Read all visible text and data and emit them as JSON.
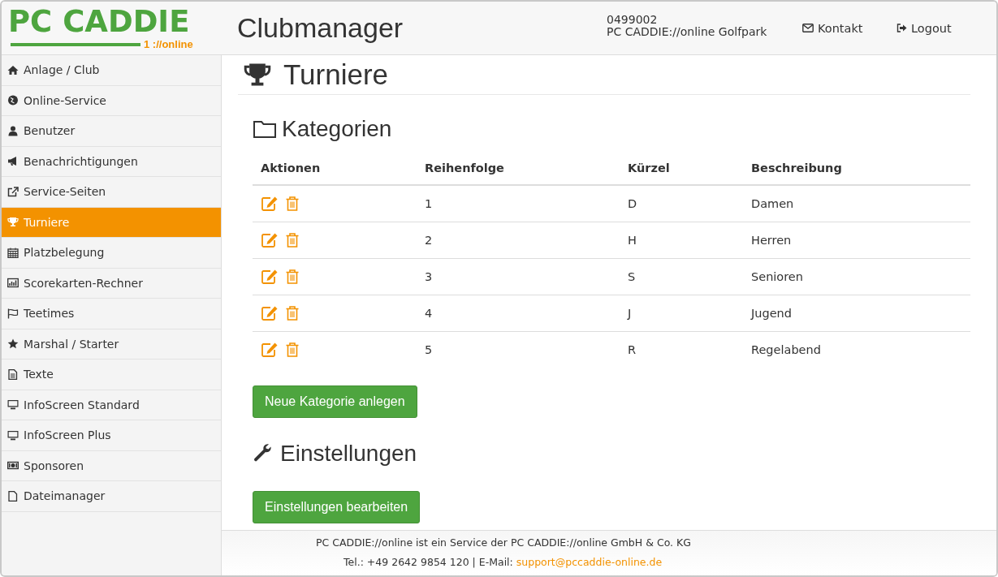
{
  "header": {
    "logo_text": "PC CADDIE",
    "logo_sub": "1 ://online",
    "app_title": "Clubmanager",
    "account_id": "0499002",
    "account_name": "PC CADDIE://online Golfpark",
    "links": [
      {
        "label": "Kontakt",
        "kind": "mail"
      },
      {
        "label": "Logout",
        "kind": "logout"
      }
    ]
  },
  "sidebar": {
    "items": [
      {
        "label": "Anlage / Club",
        "selected": false
      },
      {
        "label": "Online-Service",
        "selected": false
      },
      {
        "label": "Benutzer",
        "selected": false
      },
      {
        "label": "Benachrichtigungen",
        "selected": false
      },
      {
        "label": "Service-Seiten",
        "selected": false
      },
      {
        "label": "Turniere",
        "selected": true
      },
      {
        "label": "Platzbelegung",
        "selected": false
      },
      {
        "label": "Scorekarten-Rechner",
        "selected": false
      },
      {
        "label": "Teetimes",
        "selected": false
      },
      {
        "label": "Marshal / Starter",
        "selected": false
      },
      {
        "label": "Texte",
        "selected": false
      },
      {
        "label": "InfoScreen Standard",
        "selected": false
      },
      {
        "label": "InfoScreen Plus",
        "selected": false
      },
      {
        "label": "Sponsoren",
        "selected": false
      },
      {
        "label": "Dateimanager",
        "selected": false
      }
    ]
  },
  "page_title": "Turniere",
  "categories": {
    "heading": "Kategorien",
    "table": {
      "columns": [
        "Aktionen",
        "Reihenfolge",
        "Kürzel",
        "Beschreibung"
      ],
      "rows": [
        {
          "order": "1",
          "short": "D",
          "description": "Damen"
        },
        {
          "order": "2",
          "short": "H",
          "description": "Herren"
        },
        {
          "order": "3",
          "short": "S",
          "description": "Senioren"
        },
        {
          "order": "4",
          "short": "J",
          "description": "Jugend"
        },
        {
          "order": "5",
          "short": "R",
          "description": "Regelabend"
        }
      ]
    },
    "button": "Neue Kategorie anlegen"
  },
  "settings": {
    "heading": "Einstellungen",
    "button": "Einstellungen bearbeiten"
  },
  "footer": {
    "line1": "PC CADDIE://online ist ein Service der PC CADDIE://online GmbH & Co. KG",
    "contact": "Tel.: +49 2642 9854 120 | E-Mail:",
    "email": "support@pccaddie-online.de"
  }
}
